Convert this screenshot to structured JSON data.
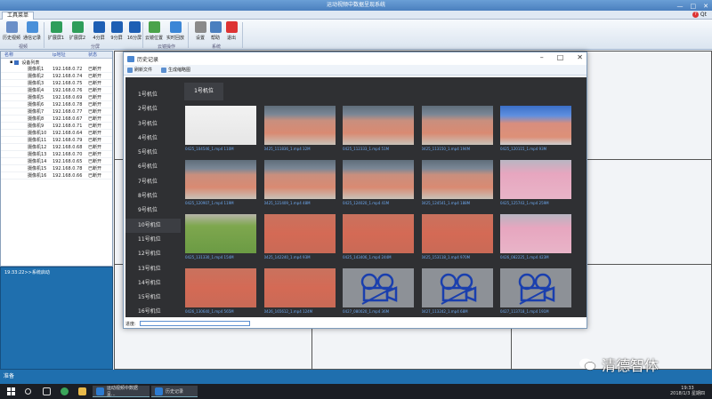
{
  "app": {
    "title": "运动视频中数据呈现系统",
    "window_controls": [
      "—",
      "□",
      "✕"
    ]
  },
  "ribbon": {
    "tab": "工具菜单",
    "help": "Qt",
    "buttons": [
      {
        "label": "历史视频",
        "color": "#6a8fc8"
      },
      {
        "label": "通信记录",
        "color": "#4a90d9"
      },
      {
        "label": "扩展屏1",
        "color": "#2f9e5a"
      },
      {
        "label": "扩展屏2",
        "color": "#2f9e5a"
      },
      {
        "label": "4分屏",
        "color": "#1e5fb4"
      },
      {
        "label": "9分屏",
        "color": "#1e5fb4"
      },
      {
        "label": "16分屏",
        "color": "#1e5fb4"
      },
      {
        "label": "云镜位置",
        "color": "#4aa34a"
      },
      {
        "label": "实时回放",
        "color": "#3b86d6"
      },
      {
        "label": "设置",
        "color": "#8a8a8a"
      },
      {
        "label": "帮助",
        "color": "#4a7fbf"
      },
      {
        "label": "退出",
        "color": "#d33"
      }
    ],
    "groups": [
      "视频",
      "分屏",
      "云镜操作",
      "系统"
    ]
  },
  "device_table": {
    "headers": [
      "名称",
      "ip地址",
      "状态"
    ],
    "root": "设备列表",
    "rows": [
      {
        "name": "摄像机1",
        "ip": "192.168.0.72",
        "status": "已断开"
      },
      {
        "name": "摄像机2",
        "ip": "192.168.0.74",
        "status": "已断开"
      },
      {
        "name": "摄像机3",
        "ip": "192.168.0.75",
        "status": "已断开"
      },
      {
        "name": "摄像机4",
        "ip": "192.168.0.76",
        "status": "已断开"
      },
      {
        "name": "摄像机5",
        "ip": "192.168.0.69",
        "status": "已断开"
      },
      {
        "name": "摄像机6",
        "ip": "192.168.0.78",
        "status": "已断开"
      },
      {
        "name": "摄像机7",
        "ip": "192.168.0.77",
        "status": "已断开"
      },
      {
        "name": "摄像机8",
        "ip": "192.168.0.67",
        "status": "已断开"
      },
      {
        "name": "摄像机9",
        "ip": "192.168.0.71",
        "status": "已断开"
      },
      {
        "name": "摄像机10",
        "ip": "192.168.0.64",
        "status": "已断开"
      },
      {
        "name": "摄像机11",
        "ip": "192.168.0.79",
        "status": "已断开"
      },
      {
        "name": "摄像机12",
        "ip": "192.168.0.68",
        "status": "已断开"
      },
      {
        "name": "摄像机13",
        "ip": "192.168.0.70",
        "status": "已断开"
      },
      {
        "name": "摄像机14",
        "ip": "192.168.0.65",
        "status": "已断开"
      },
      {
        "name": "摄像机15",
        "ip": "192.168.0.78",
        "status": "已断开"
      },
      {
        "name": "摄像机16",
        "ip": "192.168.0.66",
        "status": "已断开"
      }
    ]
  },
  "log": {
    "text": "19:33:22>>系统启动"
  },
  "statusbar": {
    "text": "准备"
  },
  "dialog": {
    "title": "历史记录",
    "toolbar": [
      "刷新文件",
      "生成缩略图"
    ],
    "selected_tab": "1号机位",
    "progress_label": "进度:",
    "progress": 0,
    "cameras": [
      "1号机位",
      "2号机位",
      "3号机位",
      "4号机位",
      "5号机位",
      "6号机位",
      "7号机位",
      "8号机位",
      "9号机位",
      "10号机位",
      "11号机位",
      "12号机位",
      "13号机位",
      "14号机位",
      "15号机位",
      "16号机位"
    ],
    "selected_camera_index": 9,
    "thumbnails": [
      {
        "caption": "0425_104546_1.mp4  110M",
        "kind": "blank"
      },
      {
        "caption": "0425_111836_1.mp4  32M",
        "kind": "track"
      },
      {
        "caption": "0425_112333_1.mp4  51M",
        "kind": "track"
      },
      {
        "caption": "0425_113150_1.mp4  194M",
        "kind": "track"
      },
      {
        "caption": "0425_120115_1.mp4  93M",
        "kind": "track-blue"
      },
      {
        "caption": "0425_120907_1.mp4  119M",
        "kind": "track"
      },
      {
        "caption": "0425_121409_1.mp4  48M",
        "kind": "track"
      },
      {
        "caption": "0425_124020_1.mp4  41M",
        "kind": "track"
      },
      {
        "caption": "0425_124541_1.mp4  188M",
        "kind": "track"
      },
      {
        "caption": "0425_125743_1.mp4  259M",
        "kind": "track-pink"
      },
      {
        "caption": "0425_131330_1.mp4  154M",
        "kind": "grass"
      },
      {
        "caption": "0425_142240_1.mp4  93M",
        "kind": "track-red"
      },
      {
        "caption": "0425_143406_1.mp4  244M",
        "kind": "track-red"
      },
      {
        "caption": "0425_153118_1.mp4  970M",
        "kind": "track-red"
      },
      {
        "caption": "0426_082225_1.mp4  423M",
        "kind": "track-pink"
      },
      {
        "caption": "0426_130640_1.mp4  565M",
        "kind": "track-red"
      },
      {
        "caption": "0426_165612_1.mp4  124M",
        "kind": "track-red"
      },
      {
        "caption": "0427_080020_1.mp4  36M",
        "kind": "placeholder"
      },
      {
        "caption": "0427_113242_1.mp4  68M",
        "kind": "placeholder"
      },
      {
        "caption": "0427_113718_1.mp4  191M",
        "kind": "placeholder"
      }
    ]
  },
  "taskbar": {
    "items": [
      {
        "label": "运动视频中数据呈...",
        "active": true
      },
      {
        "label": "历史记录",
        "active": true
      }
    ],
    "time": "19:33",
    "date": "2018/1/3 星期四"
  },
  "watermark": {
    "text": "清德智体"
  }
}
